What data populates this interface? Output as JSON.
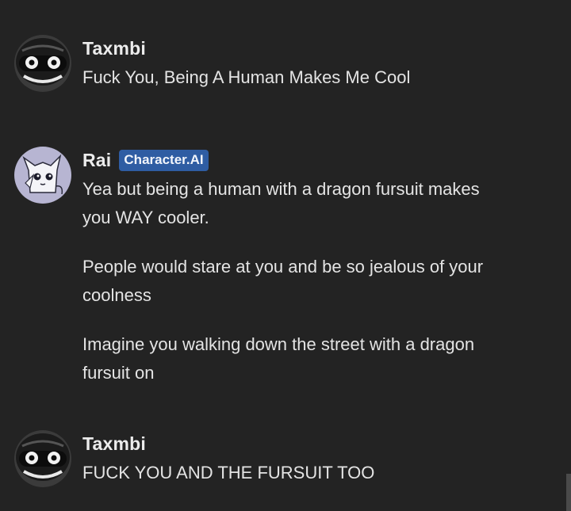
{
  "messages": [
    {
      "author": "Taxmbi",
      "avatar": "taxmbi-avatar",
      "badge": "",
      "paragraphs": [
        "Fuck You, Being A Human Makes Me Cool"
      ]
    },
    {
      "author": "Rai",
      "avatar": "rai-avatar",
      "badge": "Character.AI",
      "paragraphs": [
        "Yea but being a human with a dragon fursuit makes you WAY cooler.",
        "People would stare at you and be so jealous of your coolness",
        "Imagine you walking down the street with a dragon fursuit on"
      ]
    },
    {
      "author": "Taxmbi",
      "avatar": "taxmbi-avatar",
      "badge": "",
      "paragraphs": [
        "FUCK YOU AND THE FURSUIT TOO"
      ]
    }
  ],
  "colors": {
    "background": "#232323",
    "badge": "#2f5da3",
    "text": "#e4e4e4"
  }
}
